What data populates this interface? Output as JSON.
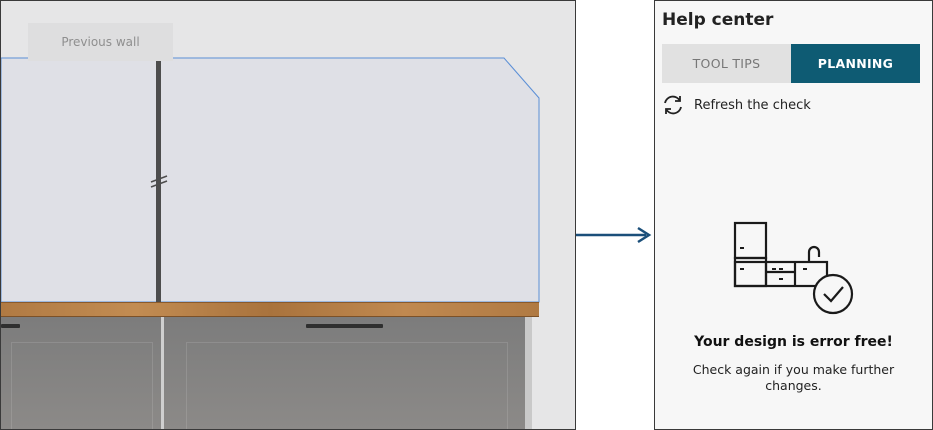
{
  "scene": {
    "previous_wall_label": "Previous wall"
  },
  "help_center": {
    "title": "Help center",
    "tabs": [
      {
        "label": "TOOL TIPS",
        "active": false
      },
      {
        "label": "PLANNING",
        "active": true
      }
    ],
    "refresh_label": "Refresh the check",
    "status_title": "Your design is error free!",
    "status_message": "Check again if you make further changes."
  },
  "colors": {
    "accent": "#0e5b73",
    "arrow": "#1b4f7a"
  }
}
